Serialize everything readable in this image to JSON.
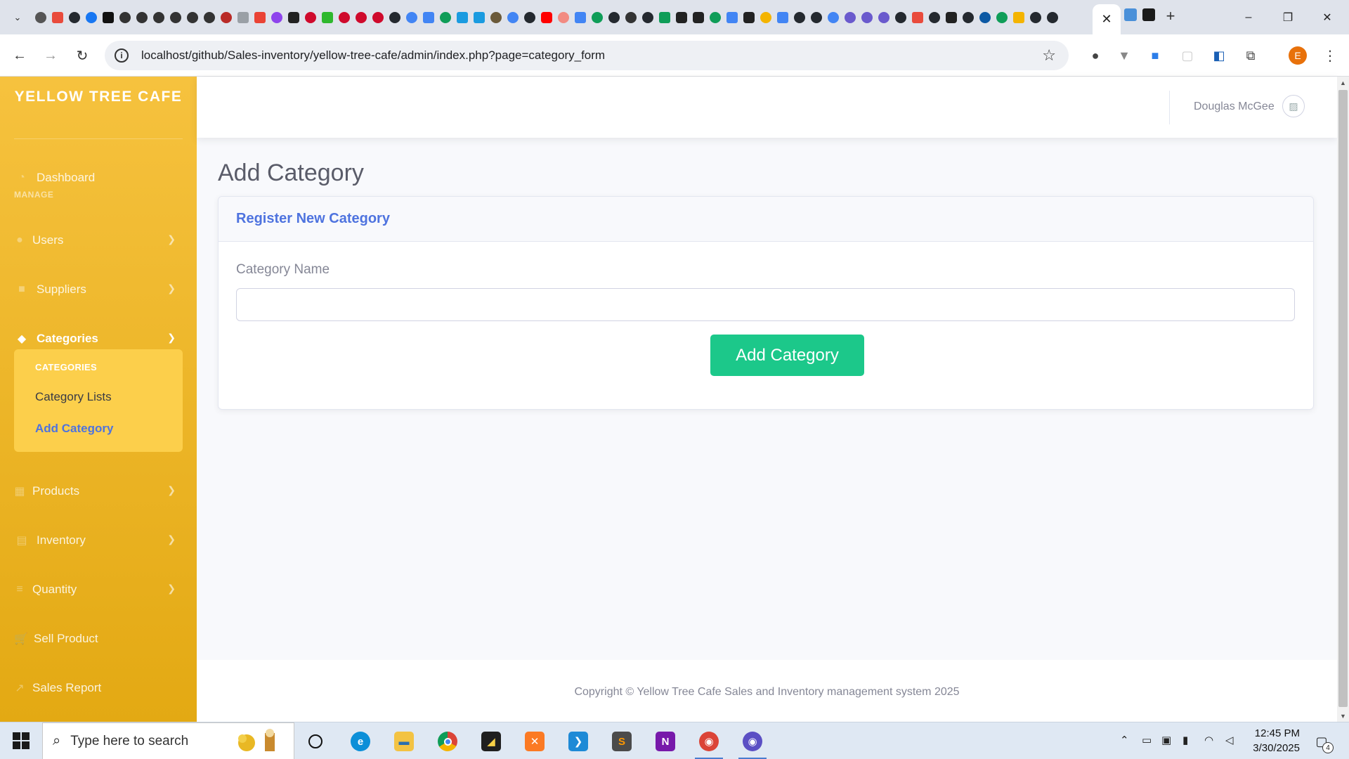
{
  "browser": {
    "active_tab_close": "✕",
    "new_tab": "+",
    "url": "localhost/github/Sales-inventory/yellow-tree-cafe/admin/index.php?page=category_form",
    "profile_initial": "E",
    "window_controls": {
      "minimize": "–",
      "restore": "❐",
      "close": "✕"
    }
  },
  "sidebar": {
    "brand": "YELLOW TREE CAFE",
    "dashboard": "Dashboard",
    "section_label": "MANAGE",
    "items": [
      {
        "label": "Users",
        "icon": "user-icon"
      },
      {
        "label": "Suppliers",
        "icon": "truck-icon"
      },
      {
        "label": "Categories",
        "icon": "tags-icon"
      },
      {
        "label": "Products",
        "icon": "box-icon"
      },
      {
        "label": "Inventory",
        "icon": "warehouse-icon"
      },
      {
        "label": "Quantity",
        "icon": "sort-amount-icon"
      },
      {
        "label": "Sell Product",
        "icon": "cart-icon"
      },
      {
        "label": "Sales Report",
        "icon": "chart-line-icon"
      }
    ],
    "submenu": {
      "header": "CATEGORIES",
      "items": [
        "Category Lists",
        "Add Category"
      ]
    }
  },
  "topbar": {
    "user_name": "Douglas McGee"
  },
  "main": {
    "page_title": "Add Category",
    "card_title": "Register New Category",
    "field_label": "Category Name",
    "field_value": "",
    "submit_label": "Add Category"
  },
  "footer": {
    "text": "Copyright © Yellow Tree Cafe Sales and Inventory management system 2025"
  },
  "taskbar": {
    "search_placeholder": "Type here to search",
    "time": "12:45 PM",
    "date": "3/30/2025",
    "notification_count": "4"
  },
  "colors": {
    "sidebar_top": "#f6c23e",
    "sidebar_bottom": "#e3a913",
    "primary": "#4e73df",
    "success": "#1cc88a"
  }
}
